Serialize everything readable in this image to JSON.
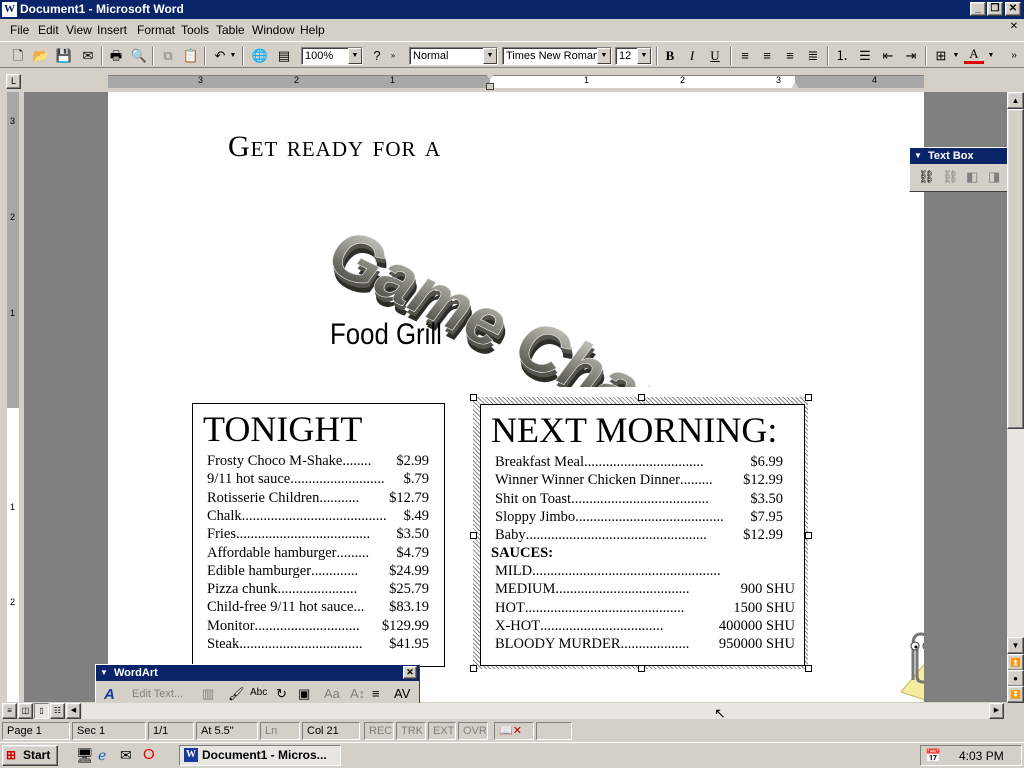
{
  "window": {
    "title": "Document1 - Microsoft Word",
    "app_icon": "W"
  },
  "menu": [
    "File",
    "Edit",
    "View",
    "Insert",
    "Format",
    "Tools",
    "Table",
    "Window",
    "Help"
  ],
  "toolbar": {
    "zoom": "100%",
    "style": "Normal",
    "font": "Times New Roman",
    "size": "12",
    "bold": "B",
    "italic": "I",
    "underline": "U",
    "font_color_glyph": "A"
  },
  "ruler": {
    "numbers": [
      "3",
      "2",
      "1",
      "1",
      "1",
      "2",
      "3",
      "4"
    ]
  },
  "vruler": {
    "numbers": [
      "3",
      "2",
      "1",
      "1",
      "2"
    ]
  },
  "document": {
    "heading": "Get ready for a",
    "wordart": "Game Changer!",
    "subtitle": "Food Grill",
    "left_box": {
      "title": "TONIGHT",
      "items": [
        {
          "name": "Frosty Choco M-Shake",
          "dots": "........",
          "price": "$2.99"
        },
        {
          "name": "9/11 hot sauce",
          "dots": "..........................",
          "price": "$.79"
        },
        {
          "name": "Rotisserie Children",
          "dots": "...........",
          "price": "$12.79"
        },
        {
          "name": "Chalk",
          "dots": "........................................",
          "price": "$.49"
        },
        {
          "name": "Fries",
          "dots": ".....................................",
          "price": "$3.50"
        },
        {
          "name": "Affordable hamburger",
          "dots": ".........",
          "price": "$4.79"
        },
        {
          "name": "Edible hamburger",
          "dots": ".............",
          "price": "$24.99"
        },
        {
          "name": "Pizza chunk",
          "dots": "......................",
          "price": "$25.79"
        },
        {
          "name": "Child-free 9/11 hot sauce",
          "dots": "...",
          "price": "$83.19"
        },
        {
          "name": "Monitor",
          "dots": ".............................",
          "price": "$129.99"
        },
        {
          "name": "Steak",
          "dots": "..................................",
          "price": "$41.95"
        }
      ]
    },
    "right_box": {
      "title": "NEXT MORNING:",
      "items": [
        {
          "name": "Breakfast Meal",
          "dots": ".................................",
          "price": "$6.99"
        },
        {
          "name": "Winner Winner Chicken Dinner",
          "dots": ".........",
          "price": "$12.99"
        },
        {
          "name": "Shit on Toast",
          "dots": "......................................",
          "price": "$3.50"
        },
        {
          "name": "Sloppy Jimbo",
          "dots": ".........................................",
          "price": "$7.95"
        },
        {
          "name": "Baby",
          "dots": "..................................................",
          "price": "$12.99"
        }
      ],
      "sauces_label": "SAUCES:",
      "sauces": [
        {
          "name": "MILD",
          "dots": "....................................................",
          "price": ""
        },
        {
          "name": "MEDIUM",
          "dots": ".....................................",
          "price": "900 SHU"
        },
        {
          "name": "HOT",
          "dots": "............................................",
          "price": "1500 SHU"
        },
        {
          "name": "X-HOT",
          "dots": "..................................",
          "price": "400000 SHU"
        },
        {
          "name": "BLOODY MURDER",
          "dots": "...................",
          "price": "950000 SHU"
        }
      ]
    }
  },
  "textbox_toolbar": {
    "title": "Text Box"
  },
  "wordart_toolbar": {
    "title": "WordArt",
    "edit_text": "Edit Text..."
  },
  "status": {
    "page": "Page 1",
    "sec": "Sec 1",
    "pages": "1/1",
    "at": "At 5.5\"",
    "ln": "Ln",
    "col": "Col 21",
    "rec": "REC",
    "trk": "TRK",
    "ext": "EXT",
    "ovr": "OVR"
  },
  "taskbar": {
    "start": "Start",
    "task": "Document1 - Micros...",
    "clock": "4:03 PM"
  }
}
